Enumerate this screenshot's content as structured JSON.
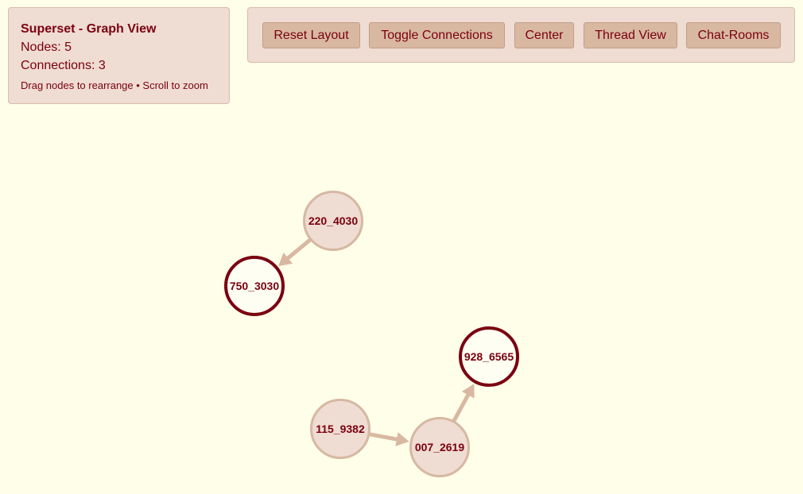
{
  "info": {
    "title": "Superset - Graph View",
    "nodes_text": "Nodes: 5",
    "connections_text": "Connections: 3",
    "hint": "Drag nodes to rearrange • Scroll to zoom"
  },
  "toolbar": {
    "buttons": [
      {
        "label": "Reset Layout"
      },
      {
        "label": "Toggle Connections"
      },
      {
        "label": "Center"
      },
      {
        "label": "Thread View"
      },
      {
        "label": "Chat-Rooms"
      }
    ]
  },
  "graph": {
    "colors": {
      "background": "#fffee9",
      "node_fill": "#efdcd2",
      "node_stroke": "#d6b8a2",
      "highlight_stroke": "#7a0010",
      "edge": "#d9b8a2",
      "label": "#7a0010"
    },
    "nodes": [
      {
        "id": "220_4030",
        "label": "220_4030",
        "highlighted": false
      },
      {
        "id": "750_3030",
        "label": "750_3030",
        "highlighted": true
      },
      {
        "id": "928_6565",
        "label": "928_6565",
        "highlighted": true
      },
      {
        "id": "115_9382",
        "label": "115_9382",
        "highlighted": false
      },
      {
        "id": "007_2619",
        "label": "007_2619",
        "highlighted": false
      }
    ],
    "edges": [
      {
        "source": "220_4030",
        "target": "750_3030"
      },
      {
        "source": "115_9382",
        "target": "007_2619"
      },
      {
        "source": "007_2619",
        "target": "928_6565"
      }
    ]
  }
}
